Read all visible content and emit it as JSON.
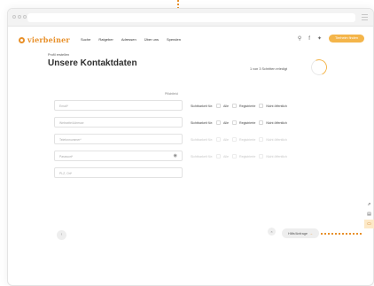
{
  "nav": {
    "brand": "vierbeiner",
    "links": [
      "Suche",
      "Ratgeber",
      "Adressen",
      "Über uns",
      "Spenden"
    ],
    "cta": "Tierheim finden"
  },
  "page": {
    "breadcrumb": "Profil erstellen",
    "title": "Unsere Kontaktdaten",
    "progress_label": "1 von 3 Schritten erledigt",
    "progress_fraction": 0.33,
    "required_note": "Pflichtfeld"
  },
  "form": {
    "fields": [
      {
        "placeholder": "Email*"
      },
      {
        "placeholder": "Webseite/Adresse"
      },
      {
        "placeholder": "Telefonnummer*"
      },
      {
        "placeholder": "Passwort*"
      },
      {
        "placeholder": "PLZ, Ort*"
      }
    ],
    "visibility_label": "Sichtbarkeit für:",
    "visibility_options": [
      "Alle",
      "Registrierte",
      "Nicht öffentlich"
    ]
  },
  "help": {
    "close": "×",
    "label": "Hilfe/Anfrage",
    "arrow": "→"
  },
  "colors": {
    "accent": "#e8902a",
    "cta": "#f4b54a"
  },
  "icons": {
    "search": "search-icon",
    "facebook": "facebook-icon",
    "twitter": "twitter-icon",
    "eye": "eye-icon"
  }
}
